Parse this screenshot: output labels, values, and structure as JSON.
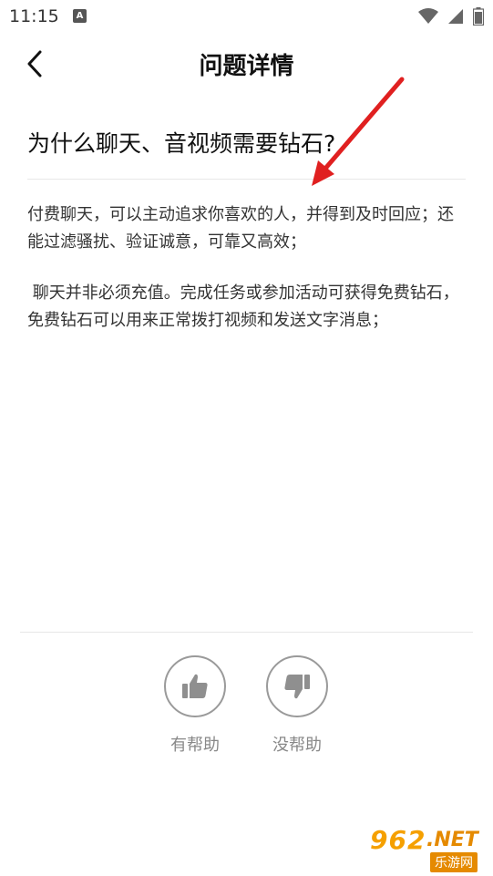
{
  "status_bar": {
    "time": "11:15",
    "notification_badge": "A"
  },
  "header": {
    "title": "问题详情"
  },
  "question": {
    "title": "为什么聊天、音视频需要钻石?"
  },
  "answer": {
    "paragraphs": [
      "付费聊天，可以主动追求你喜欢的人，并得到及时回应；还能过滤骚扰、验证诚意，可靠又高效；",
      " 聊天并非必须充值。完成任务或参加活动可获得免费钻石，免费钻石可以用来正常拨打视频和发送文字消息；"
    ]
  },
  "feedback": {
    "helpful_label": "有帮助",
    "not_helpful_label": "没帮助"
  },
  "watermark": {
    "number": "962",
    "suffix": ".NET",
    "site_name": "乐游网"
  },
  "colors": {
    "annotation_arrow": "#e02020",
    "feedback_icon": "#8f8f8f",
    "watermark_orange": "#f5a000"
  }
}
